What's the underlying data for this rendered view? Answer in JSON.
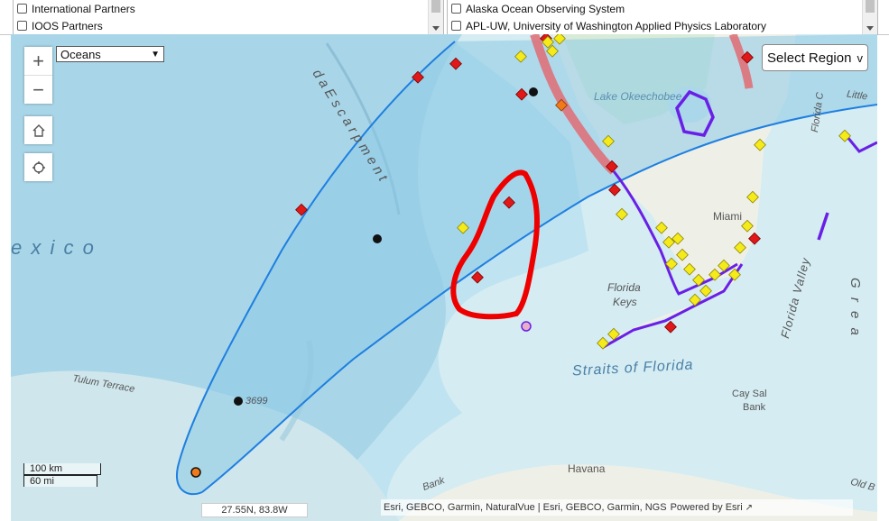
{
  "filters": {
    "left": [
      {
        "label": "International Partners",
        "checked": false
      },
      {
        "label": "IOOS Partners",
        "checked": false
      }
    ],
    "right": [
      {
        "label": "Alaska Ocean Observing System",
        "checked": false
      },
      {
        "label": "APL-UW, University of Washington Applied Physics Laboratory",
        "checked": false
      }
    ]
  },
  "map": {
    "basemap_select": {
      "value": "Oceans",
      "options": [
        "Oceans"
      ]
    },
    "region_button": "Select Region",
    "region_chevron": "v",
    "zoom_in": "+",
    "zoom_out": "−",
    "scale": {
      "km": "100 km",
      "mi": "60 mi"
    },
    "coords": "27.55N, 83.8W",
    "attribution": "Esri, GEBCO, Garmin, NaturalVue | Esri, GEBCO, Garmin, NGS",
    "powered_by": "Powered by Esri",
    "labels": {
      "mexico": "e  x  i  c  o",
      "escarpment": "d a   E s c a r p m e n t",
      "tulum": "Tulum Terrace",
      "lake": "Lake Okeechobee",
      "miami": "Miami",
      "florida_keys_1": "Florida",
      "florida_keys_2": "Keys",
      "straits": "Straits of Florida",
      "florida_valley": "Florida Valley",
      "cay_sal_1": "Cay Sal",
      "cay_sal_2": "Bank",
      "havana": "Havana",
      "great": "G r e a",
      "little": "Little",
      "florida_c": "Florida C",
      "bank": "Bank",
      "old_b": "Old B",
      "station_3699": "3699"
    },
    "colors": {
      "ocean_deep": "#a9d8ea",
      "ocean_shallow": "#d6edf2",
      "land": "#efefe8",
      "cone_fill": "#8fcfe8",
      "cone_line": "#1e7fe0",
      "red_outline": "#ee0000",
      "purple_line": "#6a1fe6",
      "pink_line": "#e06070",
      "yellow_marker": "#f5ea1a",
      "red_marker": "#e01818"
    }
  }
}
